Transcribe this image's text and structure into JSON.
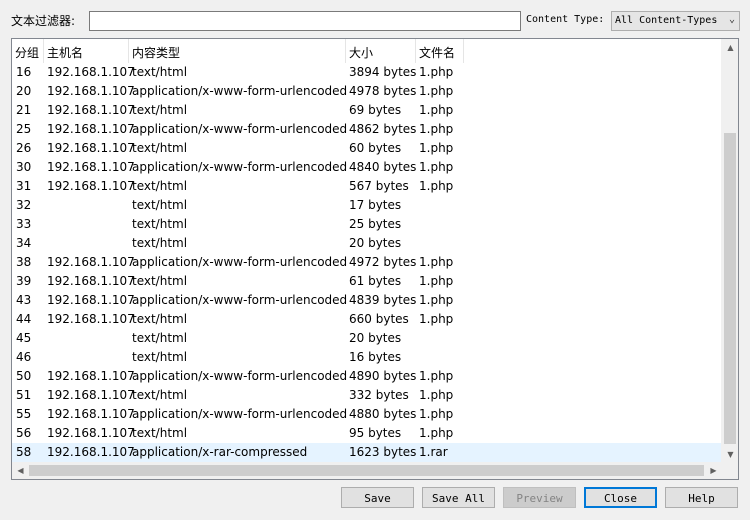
{
  "filter": {
    "label": "文本过滤器:",
    "value": "",
    "content_type_label": "Content Type:",
    "content_type_value": "All Content-Types"
  },
  "table": {
    "columns": [
      "分组",
      "主机名",
      "内容类型",
      "大小",
      "文件名"
    ],
    "rows": [
      [
        "16",
        "192.168.1.107",
        "text/html",
        "3894 bytes",
        "1.php"
      ],
      [
        "20",
        "192.168.1.107",
        "application/x-www-form-urlencoded",
        "4978 bytes",
        "1.php"
      ],
      [
        "21",
        "192.168.1.107",
        "text/html",
        "69 bytes",
        "1.php"
      ],
      [
        "25",
        "192.168.1.107",
        "application/x-www-form-urlencoded",
        "4862 bytes",
        "1.php"
      ],
      [
        "26",
        "192.168.1.107",
        "text/html",
        "60 bytes",
        "1.php"
      ],
      [
        "30",
        "192.168.1.107",
        "application/x-www-form-urlencoded",
        "4840 bytes",
        "1.php"
      ],
      [
        "31",
        "192.168.1.107",
        "text/html",
        "567 bytes",
        "1.php"
      ],
      [
        "32",
        "",
        "text/html",
        "17 bytes",
        ""
      ],
      [
        "33",
        "",
        "text/html",
        "25 bytes",
        ""
      ],
      [
        "34",
        "",
        "text/html",
        "20 bytes",
        ""
      ],
      [
        "38",
        "192.168.1.107",
        "application/x-www-form-urlencoded",
        "4972 bytes",
        "1.php"
      ],
      [
        "39",
        "192.168.1.107",
        "text/html",
        "61 bytes",
        "1.php"
      ],
      [
        "43",
        "192.168.1.107",
        "application/x-www-form-urlencoded",
        "4839 bytes",
        "1.php"
      ],
      [
        "44",
        "192.168.1.107",
        "text/html",
        "660 bytes",
        "1.php"
      ],
      [
        "45",
        "",
        "text/html",
        "20 bytes",
        ""
      ],
      [
        "46",
        "",
        "text/html",
        "16 bytes",
        ""
      ],
      [
        "50",
        "192.168.1.107",
        "application/x-www-form-urlencoded",
        "4890 bytes",
        "1.php"
      ],
      [
        "51",
        "192.168.1.107",
        "text/html",
        "332 bytes",
        "1.php"
      ],
      [
        "55",
        "192.168.1.107",
        "application/x-www-form-urlencoded",
        "4880 bytes",
        "1.php"
      ],
      [
        "56",
        "192.168.1.107",
        "text/html",
        "95 bytes",
        "1.php"
      ],
      [
        "58",
        "192.168.1.107",
        "application/x-rar-compressed",
        "1623 bytes",
        "1.rar"
      ]
    ],
    "selected_row_index": 20
  },
  "buttons": {
    "save": "Save",
    "save_all": "Save All",
    "preview": "Preview",
    "close": "Close",
    "help": "Help"
  },
  "colors": {
    "selected_row": "#e5f3ff",
    "default_button_border": "#0078d7"
  }
}
